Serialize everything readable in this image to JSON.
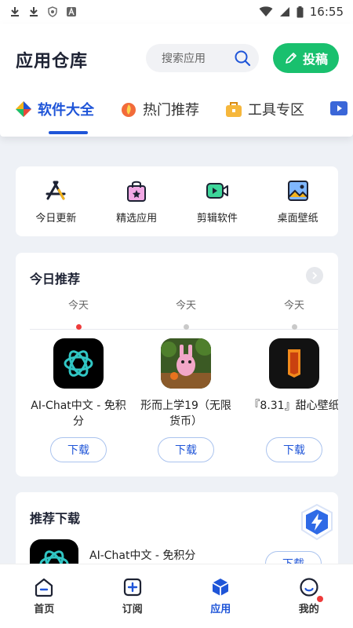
{
  "status_bar": {
    "time": "16:55"
  },
  "header": {
    "title": "应用仓库",
    "search_placeholder": "搜索应用",
    "contribute_label": "投稿"
  },
  "tabs": [
    {
      "label": "软件大全",
      "icon": "diamond-icon",
      "active": true
    },
    {
      "label": "热门推荐",
      "icon": "fire-icon",
      "active": false
    },
    {
      "label": "工具专区",
      "icon": "toolbox-icon",
      "active": false
    },
    {
      "label": "",
      "icon": "video-icon",
      "active": false
    }
  ],
  "shortcuts": [
    {
      "label": "今日更新",
      "icon": "app-store-icon"
    },
    {
      "label": "精选应用",
      "icon": "shopping-bag-icon"
    },
    {
      "label": "剪辑软件",
      "icon": "video-camera-icon"
    },
    {
      "label": "桌面壁纸",
      "icon": "image-icon"
    }
  ],
  "today": {
    "title": "今日推荐",
    "apps": [
      {
        "date": "今天",
        "name": "AI-Chat中文 - 免积分",
        "download": "下载",
        "highlight": true
      },
      {
        "date": "今天",
        "name": "形而上学19（无限货币）",
        "download": "下载",
        "highlight": false
      },
      {
        "date": "今天",
        "name": "『8.31』甜心壁纸",
        "download": "下载",
        "highlight": false
      }
    ]
  },
  "recommend": {
    "title": "推荐下载",
    "first_app": {
      "name": "AI-Chat中文 - 免积分",
      "download": "下载"
    }
  },
  "bottom_nav": [
    {
      "label": "首页",
      "icon": "home-icon",
      "active": false
    },
    {
      "label": "订阅",
      "icon": "subscribe-icon",
      "active": false
    },
    {
      "label": "应用",
      "icon": "cube-icon",
      "active": true
    },
    {
      "label": "我的",
      "icon": "profile-icon",
      "active": false
    }
  ],
  "colors": {
    "accent": "#1f55d8",
    "contribute": "#19c06e",
    "badge": "#ee3b3b"
  }
}
